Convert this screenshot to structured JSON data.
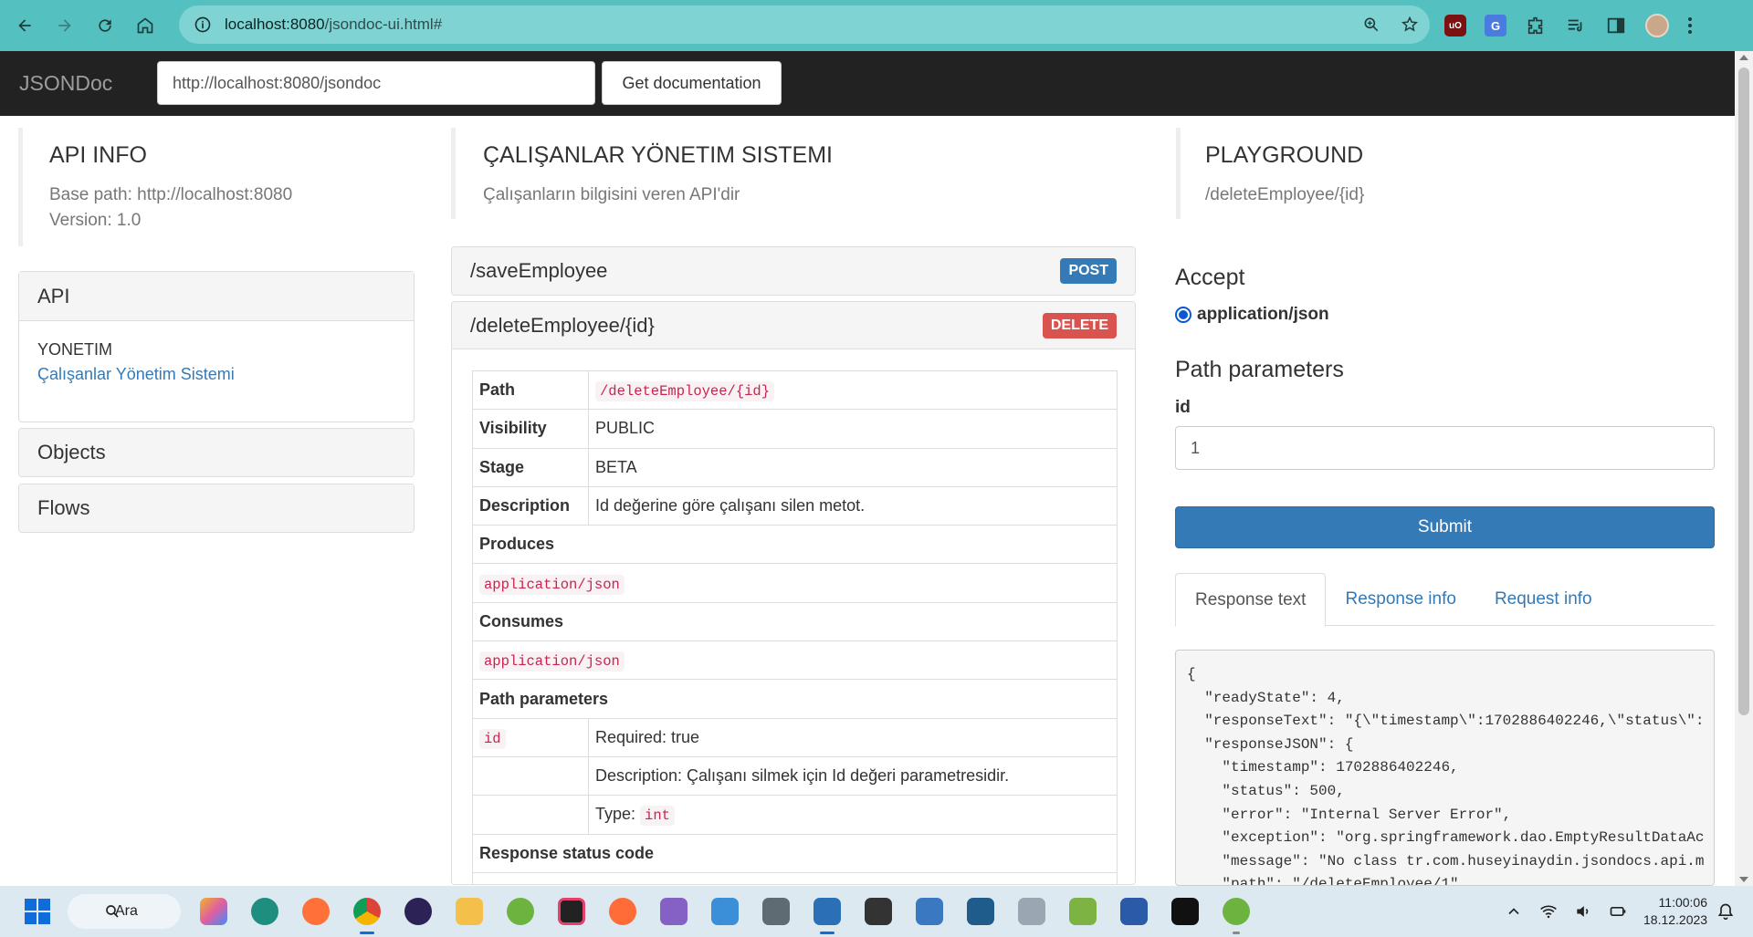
{
  "browser": {
    "url_host": "localhost:8080",
    "url_path": "/jsondoc-ui.html#"
  },
  "navbar": {
    "brand": "JSONDoc",
    "doc_url_value": "http://localhost:8080/jsondoc",
    "get_doc_label": "Get documentation"
  },
  "api_info": {
    "title": "API INFO",
    "base_path": "Base path: http://localhost:8080",
    "version": "Version: 1.0"
  },
  "sidebar": {
    "api_heading": "API",
    "group_name": "YONETIM",
    "group_link": "Çalışanlar Yönetim Sistemi",
    "objects_heading": "Objects",
    "flows_heading": "Flows"
  },
  "api_section": {
    "title": "ÇALIŞANLAR YÖNETIM SISTEMI",
    "description": "Çalışanların bilgisini veren API'dir"
  },
  "methods": [
    {
      "path": "/saveEmployee",
      "verb": "POST"
    },
    {
      "path": "/deleteEmployee/{id}",
      "verb": "DELETE"
    }
  ],
  "method_details": {
    "path_label": "Path",
    "path_value": "/deleteEmployee/{id}",
    "visibility_label": "Visibility",
    "visibility_value": "PUBLIC",
    "stage_label": "Stage",
    "stage_value": "BETA",
    "description_label": "Description",
    "description_value": "Id değerine göre çalışanı silen metot.",
    "produces_label": "Produces",
    "produces_value": "application/json",
    "consumes_label": "Consumes",
    "consumes_value": "application/json",
    "path_params_label": "Path parameters",
    "param_name": "id",
    "param_required": "Required: true",
    "param_description": "Description: Çalışanı silmek için Id değeri parametresidir.",
    "param_type_label": "Type:",
    "param_type_value": "int",
    "response_status_label": "Response status code"
  },
  "playground": {
    "title": "PLAYGROUND",
    "path": "/deleteEmployee/{id}",
    "accept_heading": "Accept",
    "accept_option": "application/json",
    "path_params_heading": "Path parameters",
    "id_label": "id",
    "id_value": "1",
    "submit_label": "Submit",
    "tabs": [
      "Response text",
      "Response info",
      "Request info"
    ],
    "response_text": "{\n  \"readyState\": 4,\n  \"responseText\": \"{\\\"timestamp\\\":1702886402246,\\\"status\\\":\n  \"responseJSON\": {\n    \"timestamp\": 1702886402246,\n    \"status\": 500,\n    \"error\": \"Internal Server Error\",\n    \"exception\": \"org.springframework.dao.EmptyResultDataAc\n    \"message\": \"No class tr.com.huseyinaydin.jsondocs.api.m\n    \"path\": \"/deleteEmployee/1\""
  },
  "taskbar": {
    "search_label": "Ara",
    "time": "11:00:06",
    "date": "18.12.2023"
  },
  "colors": {
    "browser_toolbar": "#54c0c0",
    "navbar": "#222222",
    "primary": "#337ab7",
    "danger": "#d9534f"
  }
}
